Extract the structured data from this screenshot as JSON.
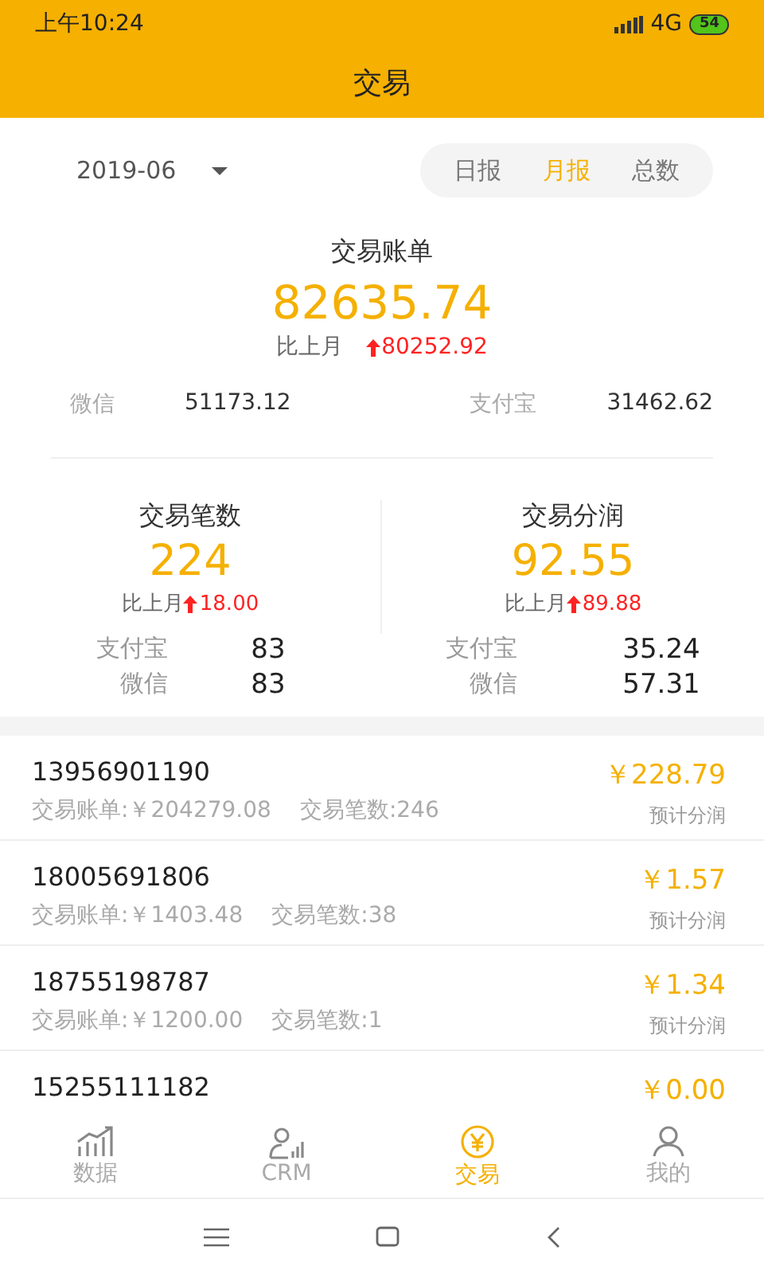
{
  "status_bar": {
    "time": "上午10:24",
    "network": "4G",
    "battery": "54"
  },
  "header": {
    "title": "交易"
  },
  "period": {
    "date": "2019-06",
    "tabs": [
      {
        "label": "日报",
        "selected": false
      },
      {
        "label": "月报",
        "selected": true
      },
      {
        "label": "总数",
        "selected": false
      }
    ]
  },
  "bill": {
    "title": "交易账单",
    "total": "82635.74",
    "compare_label": "比上月",
    "change": "80252.92",
    "breakdown": [
      {
        "label": "微信",
        "value": "51173.12"
      },
      {
        "label": "支付宝",
        "value": "31462.62"
      }
    ]
  },
  "stats": [
    {
      "title": "交易笔数",
      "value": "224",
      "compare_label": "比上月",
      "change": "18.00",
      "breakdown": [
        {
          "label": "支付宝",
          "value": "83"
        },
        {
          "label": "微信",
          "value": "83"
        }
      ]
    },
    {
      "title": "交易分润",
      "value": "92.55",
      "compare_label": "比上月",
      "change": "89.88",
      "breakdown": [
        {
          "label": "支付宝",
          "value": "35.24"
        },
        {
          "label": "微信",
          "value": "57.31"
        }
      ]
    }
  ],
  "records": [
    {
      "phone": "13956901190",
      "bill": "交易账单:￥204279.08",
      "count": "交易笔数:246",
      "amount": "￥228.79",
      "amount_label": "预计分润"
    },
    {
      "phone": "18005691806",
      "bill": "交易账单:￥1403.48",
      "count": "交易笔数:38",
      "amount": "￥1.57",
      "amount_label": "预计分润"
    },
    {
      "phone": "18755198787",
      "bill": "交易账单:￥1200.00",
      "count": "交易笔数:1",
      "amount": "￥1.34",
      "amount_label": "预计分润"
    },
    {
      "phone": "15255111182",
      "amount": "￥0.00"
    }
  ],
  "tab_bar": [
    {
      "label": "数据",
      "kind": "chart",
      "selected": false
    },
    {
      "label": "CRM",
      "kind": "crm",
      "selected": false
    },
    {
      "label": "交易",
      "kind": "yen",
      "selected": true
    },
    {
      "label": "我的",
      "kind": "person",
      "selected": false
    }
  ]
}
